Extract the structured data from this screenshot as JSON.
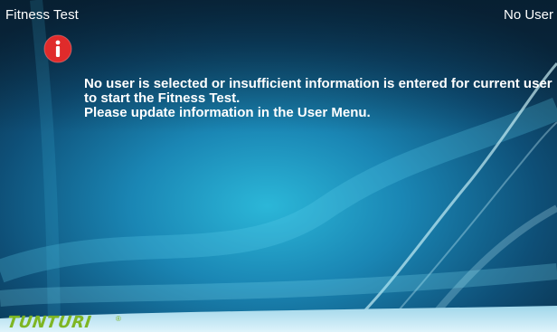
{
  "header": {
    "title": "Fitness Test",
    "user": "No User"
  },
  "alert": {
    "icon": "info-icon",
    "icon_color": "#e02b2b",
    "lines": [
      "No user is selected or insufficient information is entered for current user",
      "to start the Fitness Test.",
      "Please update information in the User Menu."
    ]
  },
  "footer": {
    "brand": "TUNTURI",
    "brand_mark": "®",
    "brand_color": "#7eb624"
  }
}
